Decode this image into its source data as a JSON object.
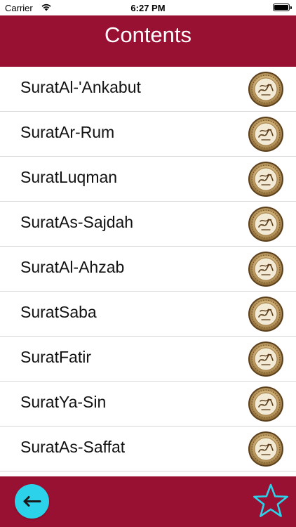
{
  "status_bar": {
    "carrier": "Carrier",
    "time": "6:27 PM",
    "wifi_icon": "wifi-icon",
    "battery_icon": "battery-icon"
  },
  "header": {
    "title": "Contents",
    "background": "#981032"
  },
  "surahs": [
    {
      "label": "SuratAl-'Ankabut",
      "icon": "quran-emblem-icon"
    },
    {
      "label": "SuratAr-Rum",
      "icon": "quran-emblem-icon"
    },
    {
      "label": "SuratLuqman",
      "icon": "quran-emblem-icon"
    },
    {
      "label": "SuratAs-Sajdah",
      "icon": "quran-emblem-icon"
    },
    {
      "label": "SuratAl-Ahzab",
      "icon": "quran-emblem-icon"
    },
    {
      "label": "SuratSaba",
      "icon": "quran-emblem-icon"
    },
    {
      "label": "SuratFatir",
      "icon": "quran-emblem-icon"
    },
    {
      "label": "SuratYa-Sin",
      "icon": "quran-emblem-icon"
    },
    {
      "label": "SuratAs-Saffat",
      "icon": "quran-emblem-icon"
    }
  ],
  "bottom_bar": {
    "back_icon": "back-arrow-icon",
    "back_color": "#2bd2ea",
    "favorite_icon": "star-icon",
    "favorite_color": "#2bd2ea"
  }
}
